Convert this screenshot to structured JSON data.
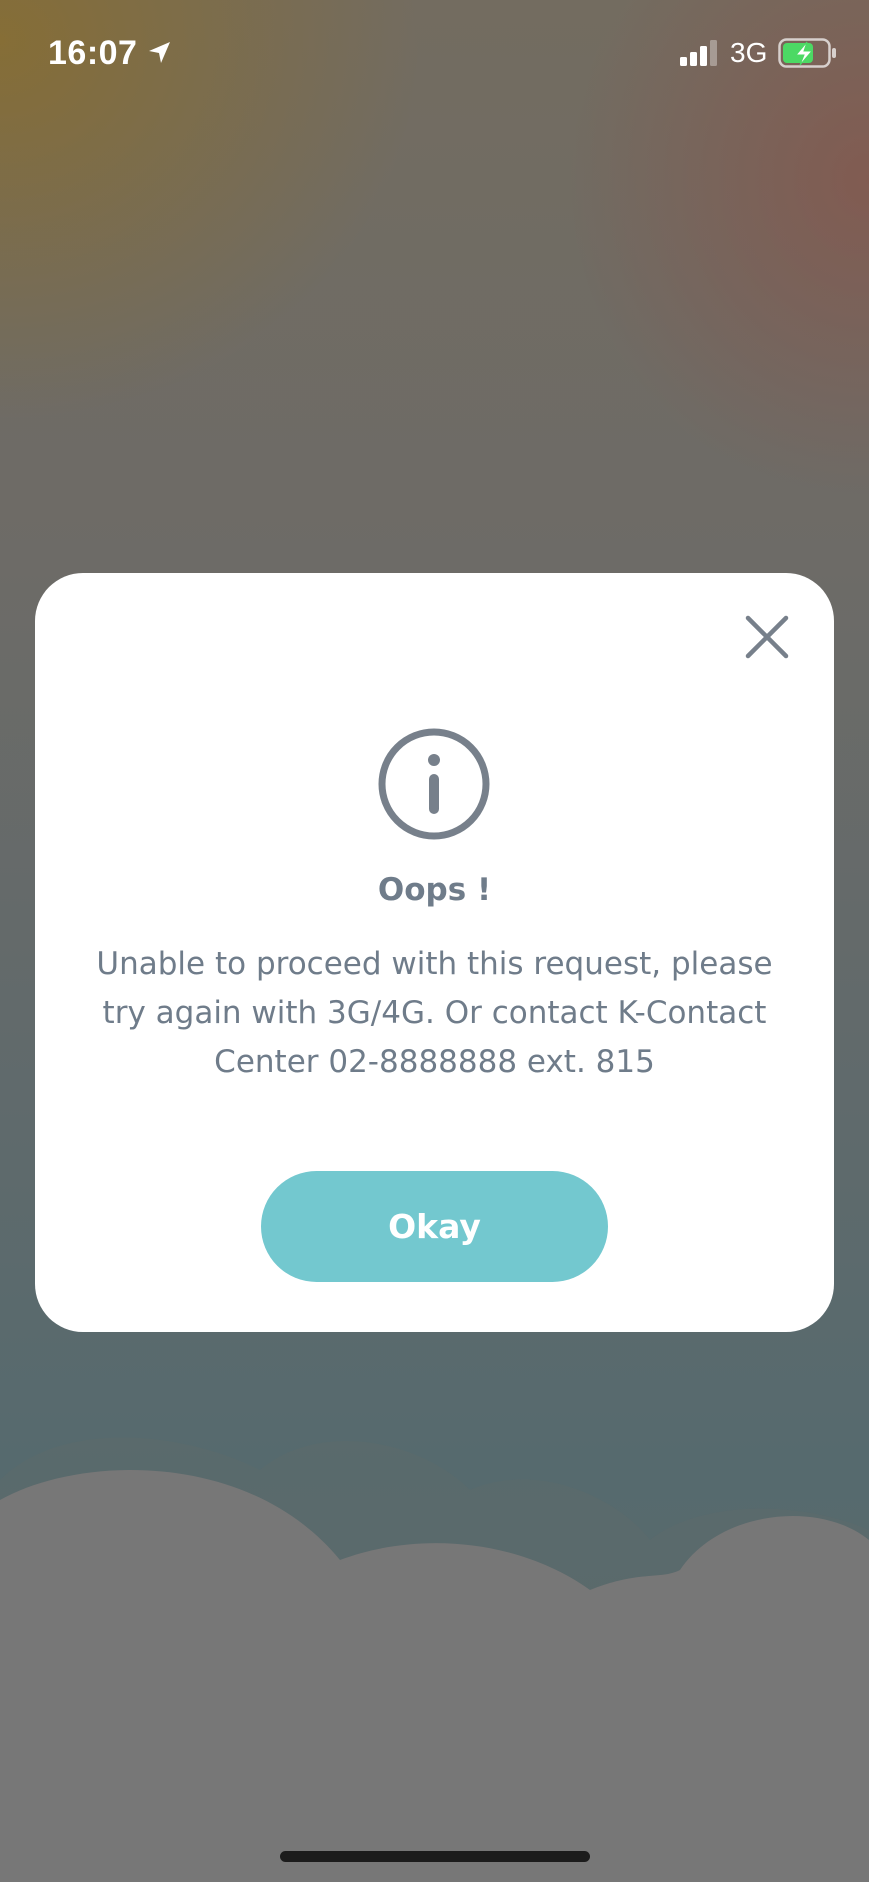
{
  "status_bar": {
    "time": "16:07",
    "network": "3G",
    "icons": {
      "location": "location-arrow-icon",
      "signal": "cellular-signal-icon",
      "battery": "battery-charging-icon"
    },
    "battery_color": "#4cd964"
  },
  "dialog": {
    "close_icon": "close-icon",
    "info_icon": "info-circle-icon",
    "title": "Oops !",
    "message_lines": [
      "Unable to proceed with this request, please",
      "try again with 3G/4G. Or contact K-Contact",
      "Center 02-8888888 ext. 815"
    ],
    "button_label": "Okay",
    "colors": {
      "accent": "#73c8cf",
      "text": "#6f7c8a",
      "icon": "#77808b"
    }
  }
}
